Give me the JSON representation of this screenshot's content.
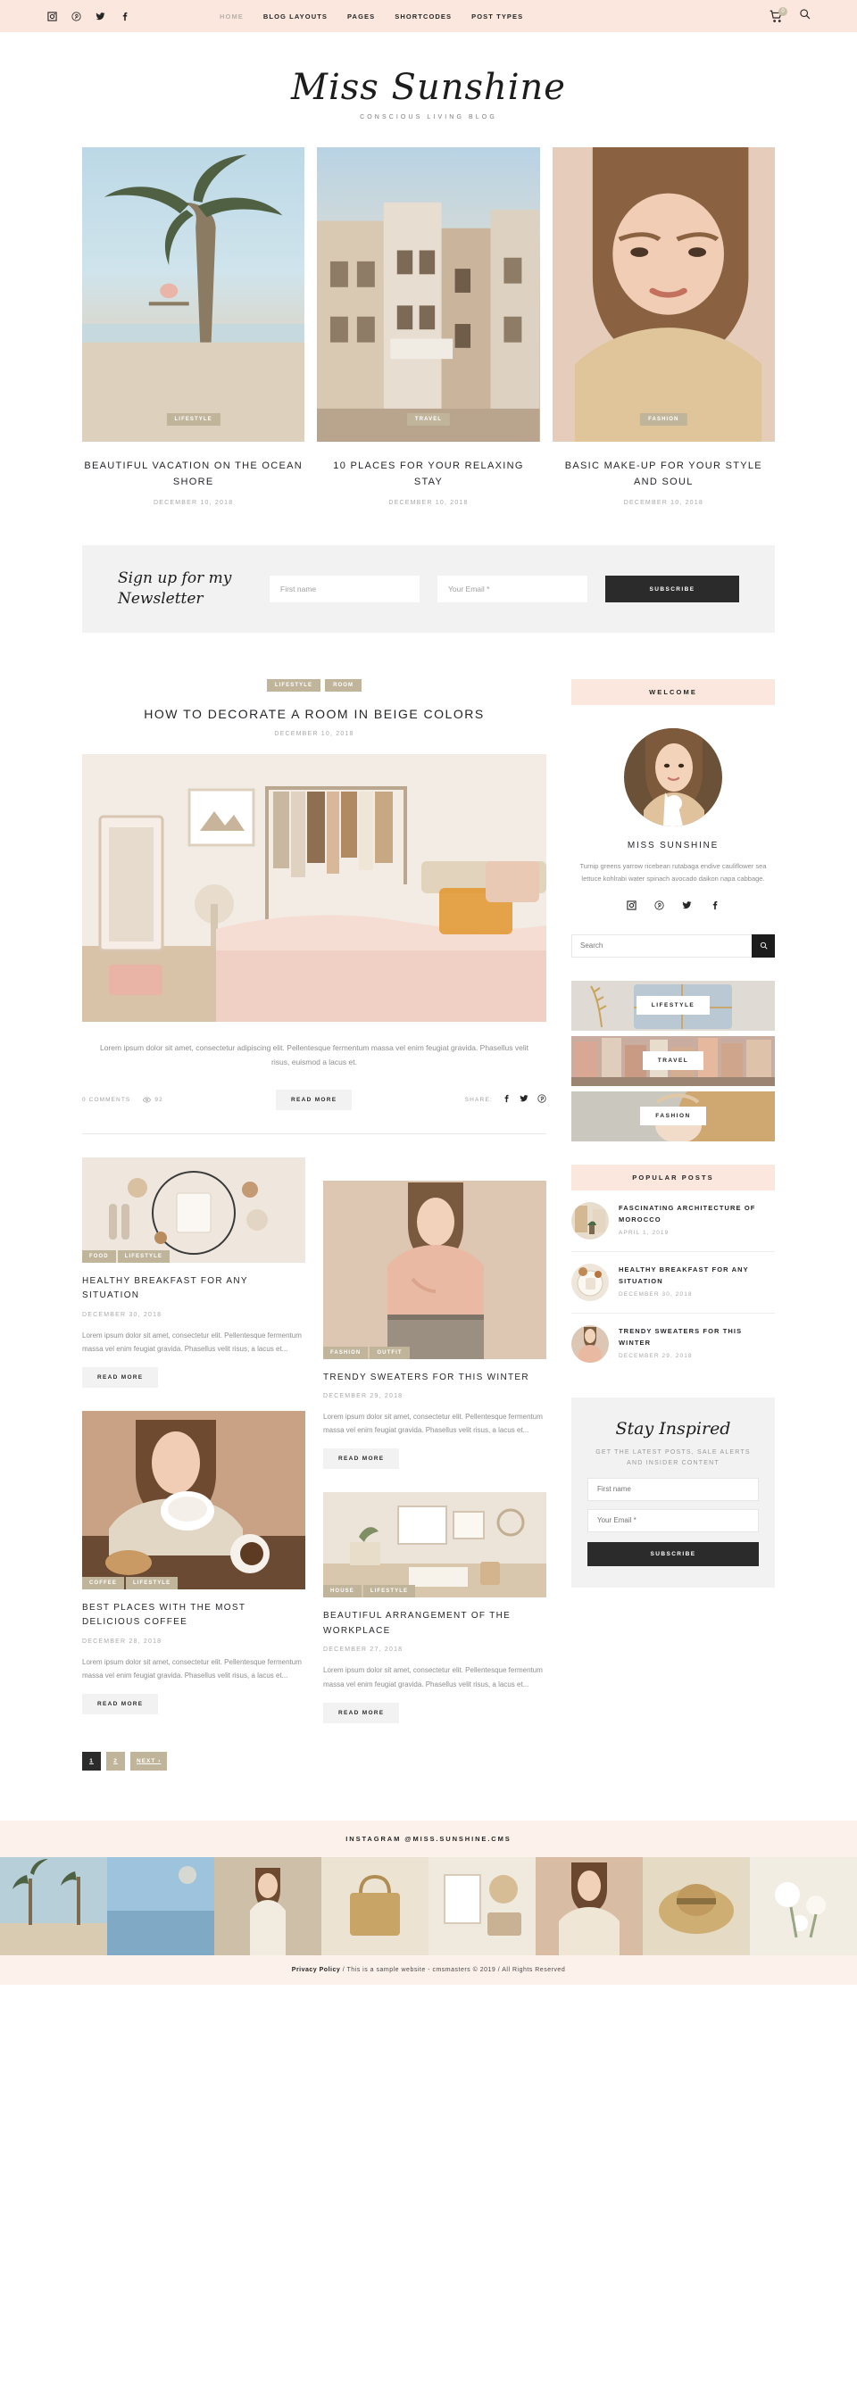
{
  "topbar": {
    "social": [
      "instagram-icon",
      "pinterest-icon",
      "twitter-icon",
      "facebook-icon"
    ],
    "nav": [
      {
        "label": "HOME",
        "active": true
      },
      {
        "label": "BLOG LAYOUTS",
        "active": false
      },
      {
        "label": "PAGES",
        "active": false
      },
      {
        "label": "SHORTCODES",
        "active": false
      },
      {
        "label": "POST TYPES",
        "active": false
      }
    ],
    "cart_count": "0",
    "bg": "#fbe7dd"
  },
  "logo": {
    "title": "Miss Sunshine",
    "tagline": "CONSCIOUS LIVING BLOG"
  },
  "featured": [
    {
      "category": "LIFESTYLE",
      "title": "BEAUTIFUL VACATION ON THE OCEAN SHORE",
      "date": "DECEMBER 10, 2018",
      "img": "palm-tree-beach-swing"
    },
    {
      "category": "TRAVEL",
      "title": "10 PLACES FOR YOUR RELAXING STAY",
      "date": "DECEMBER 10, 2018",
      "img": "european-street-buildings"
    },
    {
      "category": "FASHION",
      "title": "BASIC MAKE-UP FOR YOUR STYLE AND SOUL",
      "date": "DECEMBER 10, 2018",
      "img": "woman-portrait-makeup"
    }
  ],
  "newsletter": {
    "script": "Sign up for my Newsletter",
    "script_line1": "Sign up for my",
    "script_line2": "Newsletter",
    "first_name_placeholder": "First name",
    "email_placeholder": "Your Email *",
    "button": "SUBSCRIBE"
  },
  "hero_post": {
    "categories": [
      "LIFESTYLE",
      "ROOM"
    ],
    "title": "HOW TO DECORATE A ROOM IN BEIGE COLORS",
    "date": "DECEMBER 10, 2018",
    "excerpt": "Lorem ipsum dolor sit amet, consectetur adipiscing elit. Pellentesque fermentum massa vel enim feugiat gravida. Phasellus velit risus, euismod a lacus et.",
    "comments": "0 COMMENTS",
    "views": "92",
    "read_more": "READ MORE",
    "share_label": "SHARE:",
    "share_icons": [
      "facebook-icon",
      "twitter-icon",
      "pinterest-icon"
    ],
    "img": "bedroom-beige-clothing-rack"
  },
  "grid": {
    "left": [
      {
        "categories": [
          "FOOD",
          "LIFESTYLE"
        ],
        "title": "HEALTHY BREAKFAST FOR ANY SITUATION",
        "date": "DECEMBER 30, 2018",
        "excerpt": "Lorem ipsum dolor sit amet, consectetur elit. Pellentesque fermentum massa vel enim feugiat gravida. Phasellus velit risus, a lacus et...",
        "read_more": "READ MORE",
        "img": "breakfast-flatlay-table"
      },
      {
        "categories": [
          "COFFEE",
          "LIFESTYLE"
        ],
        "title": "BEST PLACES WITH THE MOST DELICIOUS COFFEE",
        "date": "DECEMBER 28, 2018",
        "excerpt": "Lorem ipsum dolor sit amet, consectetur elit. Pellentesque fermentum massa vel enim feugiat gravida. Phasellus velit risus, a lacus et...",
        "read_more": "READ MORE",
        "img": "woman-drinking-coffee-cafe"
      }
    ],
    "right": [
      {
        "categories": [
          "FASHION",
          "OUTFIT"
        ],
        "title": "TRENDY SWEATERS FOR THIS WINTER",
        "date": "DECEMBER 29, 2018",
        "excerpt": "Lorem ipsum dolor sit amet, consectetur elit. Pellentesque fermentum massa vel enim feugiat gravida. Phasellus velit risus, a lacus et...",
        "read_more": "READ MORE",
        "img": "woman-pink-sweater"
      },
      {
        "categories": [
          "HOUSE",
          "LIFESTYLE"
        ],
        "title": "BEAUTIFUL ARRANGEMENT OF THE WORKPLACE",
        "date": "DECEMBER 27, 2018",
        "excerpt": "Lorem ipsum dolor sit amet, consectetur elit. Pellentesque fermentum massa vel enim feugiat gravida. Phasellus velit risus, a lacus et...",
        "read_more": "READ MORE",
        "img": "workspace-desk-plants"
      }
    ]
  },
  "pagination": [
    {
      "label": "1",
      "current": true
    },
    {
      "label": "2",
      "current": false
    },
    {
      "label": "NEXT ›",
      "current": false
    }
  ],
  "sidebar": {
    "welcome": {
      "heading": "WELCOME",
      "name": "MISS SUNSHINE",
      "bio": "Turnip greens yarrow ricebean rutabaga endive cauliflower sea lettuce kohlrabi water spinach avocado daikon napa cabbage.",
      "social": [
        "instagram-icon",
        "pinterest-icon",
        "twitter-icon",
        "facebook-icon"
      ],
      "search_placeholder": "Search"
    },
    "categories": [
      {
        "label": "LIFESTYLE",
        "img": "linen-fabric-bundle"
      },
      {
        "label": "TRAVEL",
        "img": "italian-coastal-town"
      },
      {
        "label": "FASHION",
        "img": "blonde-woman-hair"
      }
    ],
    "popular": {
      "heading": "POPULAR POSTS",
      "items": [
        {
          "title": "FASCINATING ARCHITECTURE OF MOROCCO",
          "date": "APRIL 1, 2019",
          "img": "morocco-interior"
        },
        {
          "title": "HEALTHY BREAKFAST FOR ANY SITUATION",
          "date": "DECEMBER 30, 2018",
          "img": "breakfast-plate"
        },
        {
          "title": "TRENDY SWEATERS FOR THIS WINTER",
          "date": "DECEMBER 29, 2018",
          "img": "pink-sweater-woman"
        }
      ]
    },
    "stay_inspired": {
      "script": "Stay Inspired",
      "subtitle": "GET THE LATEST POSTS, SALE ALERTS AND INSIDER CONTENT",
      "first_name_placeholder": "First name",
      "email_placeholder": "Your Email *",
      "button": "SUBSCRIBE"
    }
  },
  "footer": {
    "instagram_label": "INSTAGRAM @MISS.SUNSHINE.CMS",
    "instagram_thumbs": [
      "beach-palms",
      "ocean-sky",
      "woman-beach-walk",
      "basket-bag",
      "flatlay-items",
      "woman-photos",
      "straw-hat",
      "white-flowers"
    ],
    "privacy_label": "Privacy Policy",
    "copyright": "/ This is a sample website - cmsmasters © 2019 / All Rights Reserved"
  },
  "colors": {
    "blush": "#fbe7dd",
    "blush_light": "#fdf1eb",
    "tan": "#c0b49b",
    "dark": "#2b2b2b",
    "grey_bg": "#f2f2f2"
  }
}
